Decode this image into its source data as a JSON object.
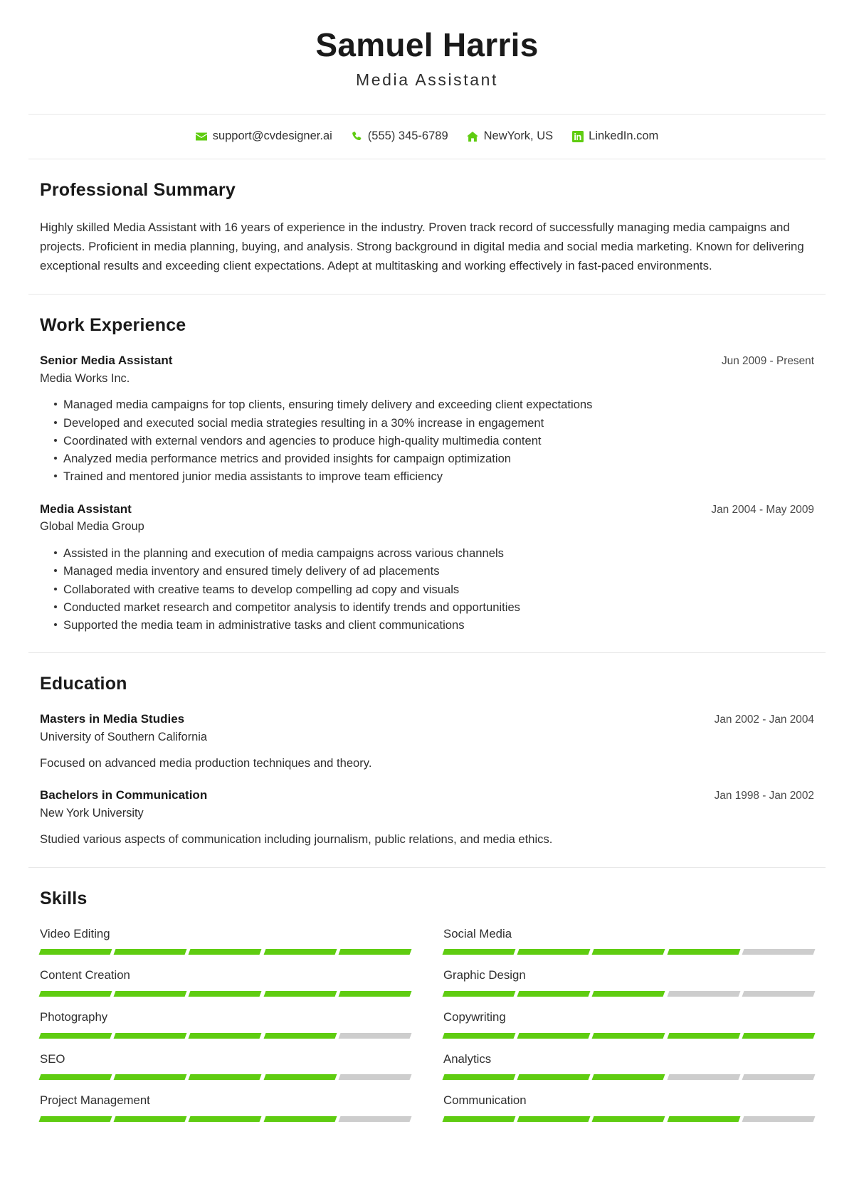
{
  "header": {
    "full_name": "Samuel Harris",
    "job_title": "Media Assistant"
  },
  "contact": {
    "email": {
      "icon": "envelope-icon",
      "text": "support@cvdesigner.ai"
    },
    "phone": {
      "icon": "phone-icon",
      "text": "(555) 345-6789"
    },
    "location": {
      "icon": "home-icon",
      "text": "NewYork, US"
    },
    "linkedin": {
      "icon": "linkedin-icon",
      "text": "LinkedIn.com"
    }
  },
  "summary": {
    "title": "Professional Summary",
    "text": "Highly skilled Media Assistant with 16 years of experience in the industry. Proven track record of successfully managing media campaigns and projects. Proficient in media planning, buying, and analysis. Strong background in digital media and social media marketing. Known for delivering exceptional results and exceeding client expectations. Adept at multitasking and working effectively in fast-paced environments."
  },
  "work": {
    "title": "Work Experience",
    "entries": [
      {
        "role": "Senior Media Assistant",
        "dates": "Jun 2009 - Present",
        "org": "Media Works Inc.",
        "bullets": [
          "Managed media campaigns for top clients, ensuring timely delivery and exceeding client expectations",
          "Developed and executed social media strategies resulting in a 30% increase in engagement",
          "Coordinated with external vendors and agencies to produce high-quality multimedia content",
          "Analyzed media performance metrics and provided insights for campaign optimization",
          "Trained and mentored junior media assistants to improve team efficiency"
        ]
      },
      {
        "role": "Media Assistant",
        "dates": "Jan 2004 - May 2009",
        "org": "Global Media Group",
        "bullets": [
          "Assisted in the planning and execution of media campaigns across various channels",
          "Managed media inventory and ensured timely delivery of ad placements",
          "Collaborated with creative teams to develop compelling ad copy and visuals",
          "Conducted market research and competitor analysis to identify trends and opportunities",
          "Supported the media team in administrative tasks and client communications"
        ]
      }
    ]
  },
  "education": {
    "title": "Education",
    "entries": [
      {
        "degree": "Masters in Media Studies",
        "dates": "Jan 2002 - Jan 2004",
        "school": "University of Southern California",
        "description": "Focused on advanced media production techniques and theory."
      },
      {
        "degree": "Bachelors in Communication",
        "dates": "Jan 1998 - Jan 2002",
        "school": "New York University",
        "description": "Studied various aspects of communication including journalism, public relations, and media ethics."
      }
    ]
  },
  "skills": {
    "title": "Skills",
    "total_segments": 5,
    "items": [
      {
        "name": "Video Editing",
        "filled": 5
      },
      {
        "name": "Social Media",
        "filled": 4
      },
      {
        "name": "Content Creation",
        "filled": 5
      },
      {
        "name": "Graphic Design",
        "filled": 3
      },
      {
        "name": "Photography",
        "filled": 4
      },
      {
        "name": "Copywriting",
        "filled": 5
      },
      {
        "name": "SEO",
        "filled": 4
      },
      {
        "name": "Analytics",
        "filled": 3
      },
      {
        "name": "Project Management",
        "filled": 4
      },
      {
        "name": "Communication",
        "filled": 4
      }
    ]
  },
  "colors": {
    "accent_green": "#5fcc11",
    "segment_empty": "#cdcdcd",
    "divider": "#e8e8e8",
    "text": "#2f2f2f",
    "heading": "#1a1a1a"
  }
}
